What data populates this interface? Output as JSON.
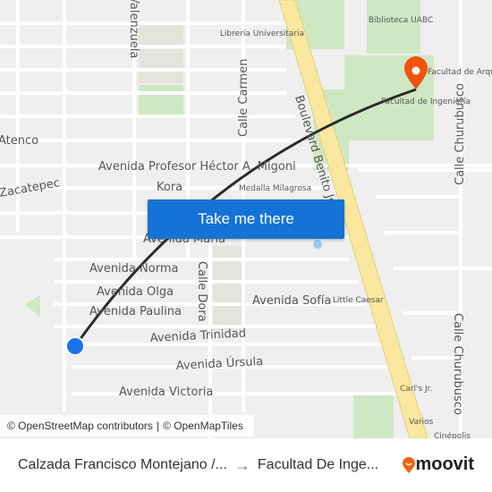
{
  "map": {
    "streets": [
      "Avenida Profesor Héctor A. Migoni",
      "Kora",
      "Medalla Milagrosa",
      "Avenida María",
      "Avenida Norma",
      "Avenida Olga",
      "Avenida Paulina",
      "Avenida Sofía",
      "Little Caesar",
      "Avenida Trinidad",
      "Avenida Úrsula",
      "Avenida Victoria",
      "Calle Dora",
      "Calle Carmen",
      "Boulevard Benito Juárez",
      "Calle Churubusco",
      "Calle Churubusco",
      "Atenco",
      "Zacatepec",
      "Valenzuela",
      "Librería Universitaria",
      "Biblioteca UABC",
      "Facultad de Arquitectura y Diseño",
      "Facultad de Ingeniería",
      "Carl's Jr.",
      "Varios",
      "Cinépolis"
    ],
    "cta_label": "Take me there",
    "attribution_osm": "© OpenStreetMap contributors",
    "attribution_sep": "|",
    "attribution_omt": "© OpenMapTiles",
    "colors": {
      "route": "#2b2b2b",
      "origin": "#1a73e8",
      "destination": "#f2530f",
      "cta": "#1473d6",
      "boulevard": "#fbe8a0",
      "park": "#cfe8c4"
    }
  },
  "footer": {
    "origin": "Calzada Francisco Montejano /...",
    "arrow": "→",
    "destination": "Facultad De Inge...",
    "brand": "moovit"
  }
}
